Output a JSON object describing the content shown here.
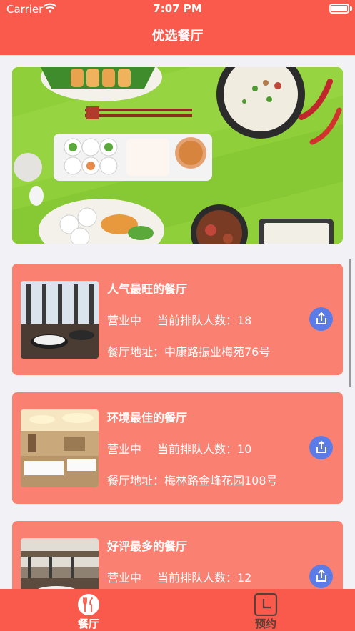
{
  "status_bar": {
    "carrier": "Carrier",
    "time": "7:07 PM"
  },
  "nav": {
    "title": "优选餐厅"
  },
  "restaurants": [
    {
      "name": "人气最旺的餐厅",
      "status": "营业中",
      "queue": "当前排队人数：18",
      "address": "餐厅地址：中康路振业梅苑76号"
    },
    {
      "name": "环境最佳的餐厅",
      "status": "营业中",
      "queue": "当前排队人数：10",
      "address": "餐厅地址：梅林路金峰花园108号"
    },
    {
      "name": "好评最多的餐厅",
      "status": "营业中",
      "queue": "当前排队人数：12",
      "address": ""
    }
  ],
  "tabs": [
    {
      "label": "餐厅",
      "icon": "fork-knife-icon",
      "active": true
    },
    {
      "label": "预约",
      "icon": "clock-icon",
      "active": false
    }
  ],
  "colors": {
    "primary": "#f95a4c",
    "card": "#fa8072",
    "share": "#5b7ce6",
    "banner": "#8ecf3a",
    "tab_inactive": "#5a3f3a"
  }
}
